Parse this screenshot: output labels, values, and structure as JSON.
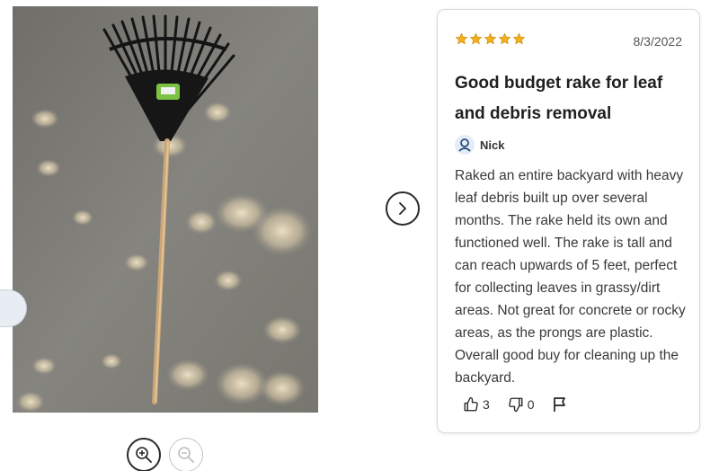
{
  "review": {
    "rating": 5,
    "date": "8/3/2022",
    "title": "Good budget rake for leaf and debris removal",
    "reviewer_name": "Nick",
    "body": "Raked an entire backyard with heavy leaf debris built up over several months. The rake held its own and functioned well. The rake is tall and can reach upwards of 5 feet, perfect for collecting leaves in grassy/dirt areas. Not great for concrete or rocky areas, as the prongs are plastic. Overall good buy for cleaning up the backyard.",
    "helpful_count": "3",
    "not_helpful_count": "0"
  },
  "icons": {
    "star": "star-icon",
    "zoom_in": "zoom-in-icon",
    "zoom_out": "zoom-out-icon",
    "next": "chevron-right-icon",
    "user": "user-icon",
    "thumbs_up": "thumbs-up-icon",
    "thumbs_down": "thumbs-down-icon",
    "flag": "flag-icon"
  },
  "colors": {
    "star": "#f2b01e",
    "text": "#3a3a3a",
    "avatar_bg": "#e3ecf9",
    "avatar_icon": "#1b3a6b"
  }
}
